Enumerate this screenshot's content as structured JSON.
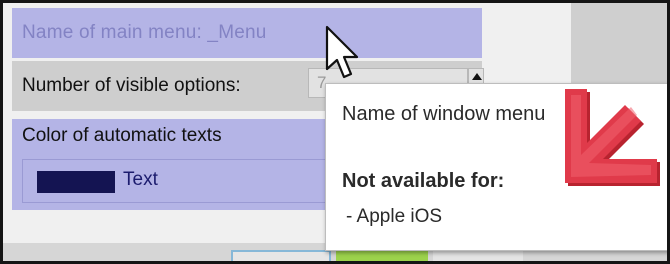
{
  "menu_name": {
    "value": "Name of main menu: _Menu"
  },
  "visible_options": {
    "label": "Number of visible options:",
    "value": "7"
  },
  "auto_text_color": {
    "label": "Color of automatic texts",
    "swatch_color": "#141452",
    "sample_text": "Text"
  },
  "tooltip": {
    "title": "Name of window menu",
    "heading": "Not available for:",
    "items": [
      "- Apple iOS"
    ]
  },
  "icons": {
    "cursor": "mouse-pointer-icon",
    "arrow": "red-arrow-icon"
  },
  "colors": {
    "row_highlight": "#b4b4e6",
    "arrow_red": "#d83545",
    "confirm_green": "#9cd24c"
  }
}
